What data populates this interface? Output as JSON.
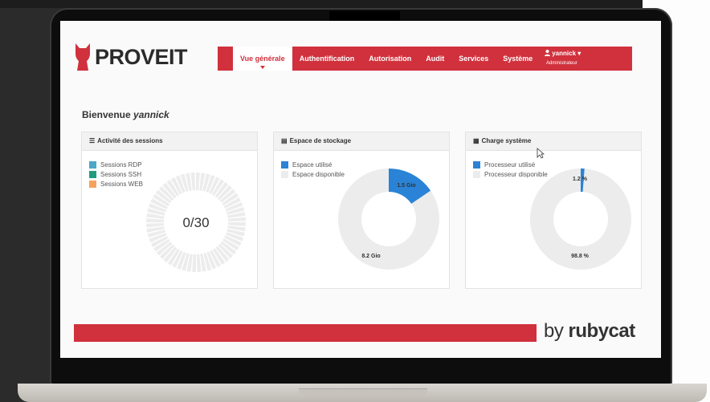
{
  "brand": {
    "logo_text": "PROVEIT",
    "primary_color": "#d0313d",
    "footer_brand_prefix": "by",
    "footer_brand_name": "rubycat"
  },
  "nav": {
    "items": [
      {
        "label": "Vue générale",
        "active": true
      },
      {
        "label": "Authentification"
      },
      {
        "label": "Autorisation"
      },
      {
        "label": "Audit"
      },
      {
        "label": "Services"
      },
      {
        "label": "Système"
      }
    ],
    "user": {
      "icon": "user-icon",
      "name": "yannick",
      "caret": "▾",
      "role": "Administrateur"
    }
  },
  "welcome": {
    "prefix": "Bienvenue ",
    "user": "yannick"
  },
  "panels": {
    "sessions": {
      "title": "Activité des sessions",
      "icon": "list-icon",
      "legend": [
        {
          "label": "Sessions RDP",
          "color": "#4aa8c8"
        },
        {
          "label": "Sessions SSH",
          "color": "#1f9c7e"
        },
        {
          "label": "Sessions WEB",
          "color": "#f5a25d"
        }
      ],
      "center_value": "0/30"
    },
    "storage": {
      "title": "Espace de stockage",
      "icon": "storage-icon",
      "legend": [
        {
          "label": "Espace utilisé",
          "color": "#2a83d6"
        },
        {
          "label": "Espace disponible",
          "color": "#ececec"
        }
      ],
      "used_label": "1.5 Gio",
      "free_label": "8.2 Gio",
      "used_fraction": 0.155
    },
    "cpu": {
      "title": "Charge système",
      "icon": "server-icon",
      "legend": [
        {
          "label": "Processeur utilisé",
          "color": "#2a83d6"
        },
        {
          "label": "Processeur disponible",
          "color": "#ececec"
        }
      ],
      "used_label": "1.2 %",
      "free_label": "98.8 %",
      "used_fraction": 0.012
    }
  }
}
